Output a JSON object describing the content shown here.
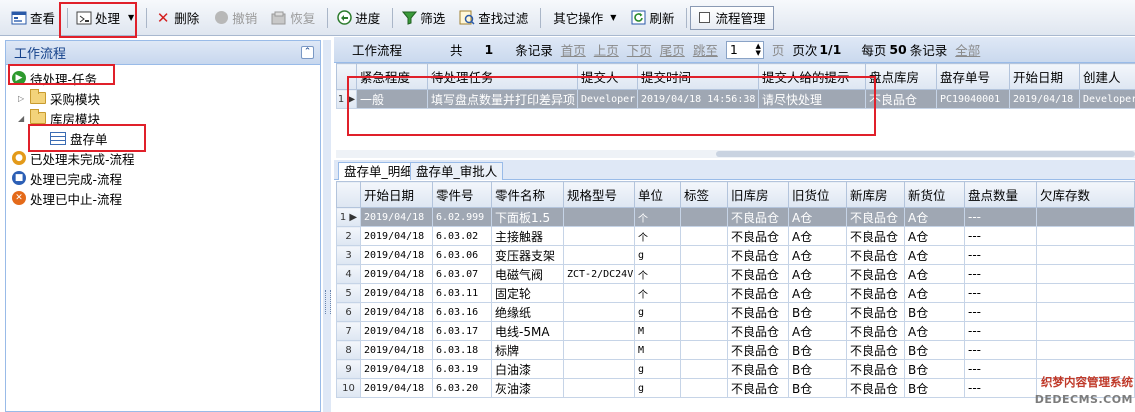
{
  "toolbar": {
    "view": "查看",
    "process": "处理",
    "delete": "删除",
    "revoke": "撤销",
    "restore": "恢复",
    "progress": "进度",
    "filter": "筛选",
    "find_filter": "查找过滤",
    "other_ops": "其它操作",
    "refresh": "刷新",
    "flow_manage": "流程管理"
  },
  "left": {
    "title": "工作流程",
    "pending": "待处理-任务",
    "purchase": "采购模块",
    "warehouse": "库房模块",
    "inventory": "盘存单",
    "done_unfinished": "已处理未完成-流程",
    "done_finished": "处理已完成-流程",
    "done_terminated": "处理已中止-流程"
  },
  "pager": {
    "title": "工作流程",
    "total_prefix": "共",
    "total": "1",
    "records": "条记录",
    "first": "首页",
    "prev": "上页",
    "next": "下页",
    "last": "尾页",
    "jump": "跳至",
    "page_value": "1",
    "page_unit": "页",
    "page_label": "页次",
    "page_info": "1/1",
    "per_page": "每页",
    "per_page_count": "50",
    "per_page_unit": "条记录",
    "all": "全部"
  },
  "top_grid": {
    "headers": [
      "紧急程度",
      "待处理任务",
      "提交人",
      "提交时间",
      "提交人给的提示",
      "盘点库房",
      "盘存单号",
      "开始日期",
      "创建人"
    ],
    "rows": [
      {
        "num": "1",
        "cells": [
          "一般",
          "填写盘点数量并打印差异项",
          "Developer",
          "2019/04/18 14:56:38",
          "请尽快处理",
          "不良品仓",
          "PC19040001",
          "2019/04/18",
          "Developer"
        ]
      }
    ]
  },
  "tabs": [
    "盘存单_明细",
    "盘存单_审批人"
  ],
  "bottom_grid": {
    "headers": [
      "开始日期",
      "零件号",
      "零件名称",
      "规格型号",
      "单位",
      "标签",
      "旧库房",
      "旧货位",
      "新库房",
      "新货位",
      "盘点数量",
      "欠库存数"
    ],
    "rows": [
      {
        "num": "1",
        "cells": [
          "2019/04/18",
          "6.02.999",
          "下面板1.5",
          "",
          "个",
          "",
          "不良品仓",
          "A仓",
          "不良品仓",
          "A仓",
          "---",
          ""
        ]
      },
      {
        "num": "2",
        "cells": [
          "2019/04/18",
          "6.03.02",
          "主接触器",
          "",
          "个",
          "",
          "不良品仓",
          "A仓",
          "不良品仓",
          "A仓",
          "---",
          ""
        ]
      },
      {
        "num": "3",
        "cells": [
          "2019/04/18",
          "6.03.06",
          "变压器支架",
          "",
          "g",
          "",
          "不良品仓",
          "A仓",
          "不良品仓",
          "A仓",
          "---",
          ""
        ]
      },
      {
        "num": "4",
        "cells": [
          "2019/04/18",
          "6.03.07",
          "电磁气阀",
          "ZCT-2/DC24V",
          "个",
          "",
          "不良品仓",
          "A仓",
          "不良品仓",
          "A仓",
          "---",
          ""
        ]
      },
      {
        "num": "5",
        "cells": [
          "2019/04/18",
          "6.03.11",
          "固定轮",
          "",
          "个",
          "",
          "不良品仓",
          "A仓",
          "不良品仓",
          "A仓",
          "---",
          ""
        ]
      },
      {
        "num": "6",
        "cells": [
          "2019/04/18",
          "6.03.16",
          "绝缘纸",
          "",
          "g",
          "",
          "不良品仓",
          "B仓",
          "不良品仓",
          "B仓",
          "---",
          ""
        ]
      },
      {
        "num": "7",
        "cells": [
          "2019/04/18",
          "6.03.17",
          "电线-5MA",
          "",
          "M",
          "",
          "不良品仓",
          "A仓",
          "不良品仓",
          "A仓",
          "---",
          ""
        ]
      },
      {
        "num": "8",
        "cells": [
          "2019/04/18",
          "6.03.18",
          "标牌",
          "",
          "M",
          "",
          "不良品仓",
          "B仓",
          "不良品仓",
          "B仓",
          "---",
          ""
        ]
      },
      {
        "num": "9",
        "cells": [
          "2019/04/18",
          "6.03.19",
          "白油漆",
          "",
          "g",
          "",
          "不良品仓",
          "B仓",
          "不良品仓",
          "B仓",
          "---",
          ""
        ]
      },
      {
        "num": "10",
        "cells": [
          "2019/04/18",
          "6.03.20",
          "灰油漆",
          "",
          "g",
          "",
          "不良品仓",
          "B仓",
          "不良品仓",
          "B仓",
          "---",
          ""
        ]
      }
    ]
  },
  "watermark": {
    "line1": "织梦内容管理系统",
    "line2": "DEDECMS.COM"
  },
  "colors": {
    "highlight_box": "#e0202a",
    "selected_row": "#9fa7b3",
    "header_blue": "#15428b"
  }
}
